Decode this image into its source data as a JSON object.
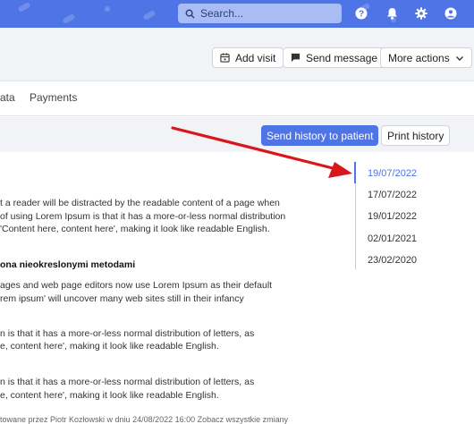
{
  "topbar": {
    "search_placeholder": "Search...",
    "icons": [
      "search-icon",
      "help-icon",
      "bell-icon",
      "gear-icon",
      "user-icon"
    ]
  },
  "header": {
    "add_visit": "Add visit",
    "send_message": "Send message",
    "more_actions": "More actions"
  },
  "tabs": {
    "partial": "ata",
    "payments": "Payments"
  },
  "toolbar": {
    "send_history": "Send history to patient",
    "print_history": "Print history"
  },
  "document": {
    "lines": [
      "t a reader will be distracted by the readable content of a page when",
      "of using Lorem Ipsum is that it has a more-or-less normal distribution",
      "'Content here, content here', making it look like readable English.",
      "ona nieokreslonymi metodami",
      "ages and web page editors now use Lorem Ipsum as their default",
      "rem ipsum' will uncover many web sites still in their infancy",
      "n is that it has a more-or-less normal distribution of letters, as",
      "e, content here', making it look like readable English.",
      "n is that it has a more-or-less normal distribution of letters, as",
      "e, content here', making it look like readable English.",
      "towane przez Piotr Kozłowski w dniu 24/08/2022 16:00 Zobacz wszystkie zmiany"
    ]
  },
  "timeline": {
    "dates": [
      "19/07/2022",
      "17/07/2022",
      "19/01/2022",
      "02/01/2021",
      "23/02/2020"
    ],
    "active_index": 0
  },
  "colors": {
    "accent": "#4f74e6",
    "arrow": "#d9161c"
  }
}
